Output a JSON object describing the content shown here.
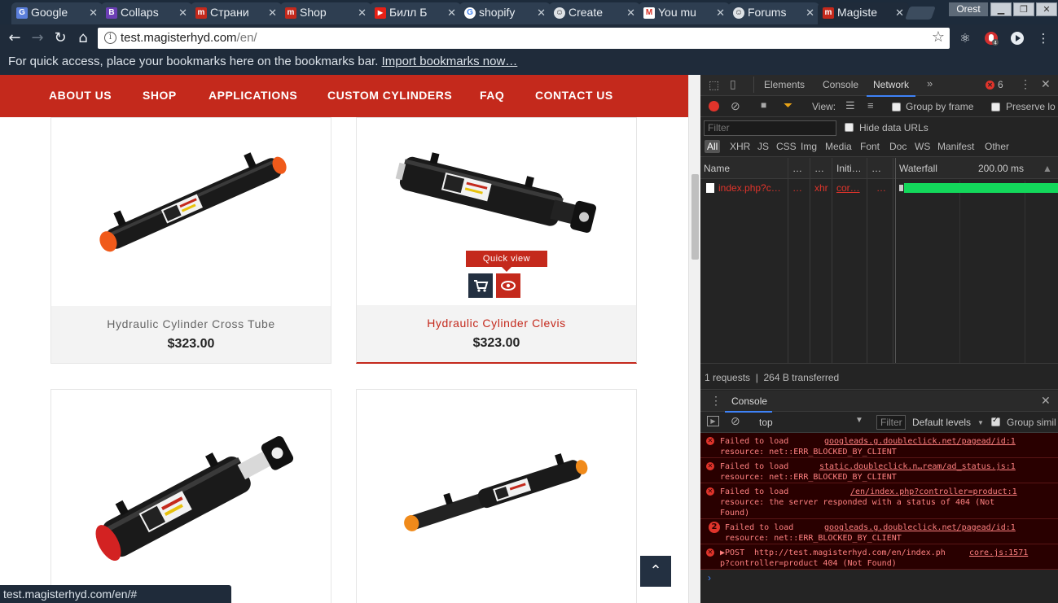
{
  "tabs": [
    {
      "label": "Google",
      "favicon": "google-docs-icon",
      "color": "#5b7fdb",
      "glyph": "G"
    },
    {
      "label": "Collaps",
      "favicon": "bootstrap-icon",
      "color": "#6c3fb5",
      "glyph": "B"
    },
    {
      "label": "Страни",
      "favicon": "magister-icon",
      "color": "#c4291c",
      "glyph": "m"
    },
    {
      "label": "Shop",
      "favicon": "magister-icon",
      "color": "#c4291c",
      "glyph": "m"
    },
    {
      "label": "Билл Б",
      "favicon": "youtube-icon",
      "color": "#e62117",
      "glyph": "▶"
    },
    {
      "label": "shopify",
      "favicon": "google-icon",
      "color": "#ffffff",
      "glyph": "G"
    },
    {
      "label": "Create",
      "favicon": "prestashop-icon",
      "color": "#dfe3e7",
      "glyph": "☺"
    },
    {
      "label": "You mu",
      "favicon": "gmail-icon",
      "color": "#ffffff",
      "glyph": "M"
    },
    {
      "label": "Forums",
      "favicon": "prestashop-icon",
      "color": "#dfe3e7",
      "glyph": "☺"
    },
    {
      "label": "Magiste",
      "favicon": "magister-icon",
      "color": "#c4291c",
      "glyph": "m"
    }
  ],
  "profile_name": "Orest",
  "url": {
    "host": "test.magisterhyd.com",
    "path": "/en/"
  },
  "bookmarks": {
    "hint": "For quick access, place your bookmarks here on the bookmarks bar.",
    "import_link": "Import bookmarks now…"
  },
  "site_nav": [
    "ABOUT US",
    "SHOP",
    "APPLICATIONS",
    "CUSTOM CYLINDERS",
    "FAQ",
    "CONTACT US"
  ],
  "products": [
    {
      "name": "Hydraulic Cylinder Cross Tube",
      "price": "$323.00"
    },
    {
      "name": "Hydraulic Cylinder Clevis",
      "price": "$323.00"
    }
  ],
  "quick_view": "Quick view",
  "status_url": "test.magisterhyd.com/en/#",
  "devtools": {
    "tabs": [
      "Elements",
      "Console",
      "Network"
    ],
    "error_count": "6",
    "network": {
      "view_label": "View:",
      "group_by_frame": "Group by frame",
      "preserve_log": "Preserve lo",
      "filter_placeholder": "Filter",
      "hide_data_urls": "Hide data URLs",
      "types": [
        "All",
        "XHR",
        "JS",
        "CSS",
        "Img",
        "Media",
        "Font",
        "Doc",
        "WS",
        "Manifest",
        "Other"
      ],
      "columns": {
        "name": "Name",
        "dots": "…",
        "initiator": "Initi…",
        "waterfall": "Waterfall",
        "time": "200.00 ms"
      },
      "request": {
        "name": "index.php?c…",
        "status": "…",
        "type": "xhr",
        "initiator": "cor…",
        "size": "…"
      },
      "summary": "1 requests  |  264 B transferred"
    },
    "console": {
      "drawer_title": "Console",
      "context": "top",
      "filter_placeholder": "Filter",
      "levels": "Default levels",
      "group_similar": "Group simil",
      "messages": [
        {
          "text": "Failed to load\nresource: net::ERR_BLOCKED_BY_CLIENT",
          "link": "googleads.g.doubleclick.net/pagead/id:1",
          "badge": "✕"
        },
        {
          "text": "Failed to load\nresource: net::ERR_BLOCKED_BY_CLIENT",
          "link": "static.doubleclick.n…ream/ad_status.js:1",
          "badge": "✕"
        },
        {
          "text": "Failed to load\nresource: the server responded with a status of 404 (Not\nFound)",
          "link": "/en/index.php?controller=product:1",
          "badge": "✕"
        },
        {
          "text": " Failed to load\n resource: net::ERR_BLOCKED_BY_CLIENT",
          "link": "googleads.g.doubleclick.net/pagead/id:1",
          "badge": "2"
        },
        {
          "text": "▶POST",
          "link": "http://test.magisterhyd.com/en/index.ph\np?controller=product 404 (Not Found)",
          "source": "core.js:1571",
          "badge": "✕"
        }
      ]
    }
  }
}
